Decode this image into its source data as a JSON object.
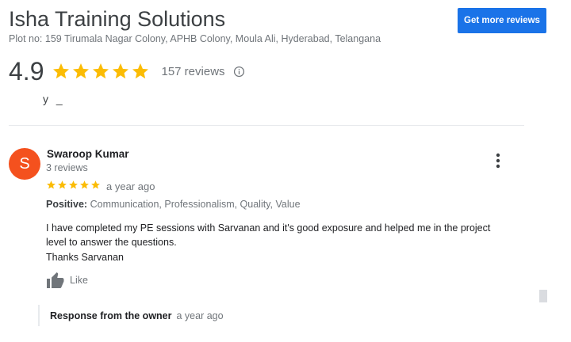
{
  "business": {
    "name": "Isha Training Solutions",
    "address": "Plot no: 159 Tirumala Nagar Colony, APHB Colony, Moula Ali, Hyderabad, Telangana",
    "rating": "4.9",
    "stars": 5,
    "review_count": "157 reviews"
  },
  "header": {
    "get_reviews_label": "Get more reviews"
  },
  "colors": {
    "star": "#fbbc04",
    "primary_button": "#1a73e8",
    "avatar": "#f4511e"
  },
  "partial_review": {
    "cut_text": "y     _"
  },
  "review": {
    "avatar_letter": "S",
    "reviewer_name": "Swaroop Kumar",
    "reviewer_reviews": "3 reviews",
    "stars": 5,
    "time": "a year ago",
    "positive_label": "Positive:",
    "positive_values": "Communication, Professionalism, Quality, Value",
    "text_lines": [
      "I have completed my PE sessions with Sarvanan and it's good exposure and helped me in the project",
      "level to answer the questions.",
      "Thanks Sarvanan"
    ],
    "like_label": "Like",
    "owner_response_label": "Response from the owner",
    "owner_response_time": "a year ago"
  },
  "icons": {
    "info": "info-icon",
    "more": "more-vert-icon",
    "like": "thumb-up-icon",
    "star": "star-icon"
  }
}
